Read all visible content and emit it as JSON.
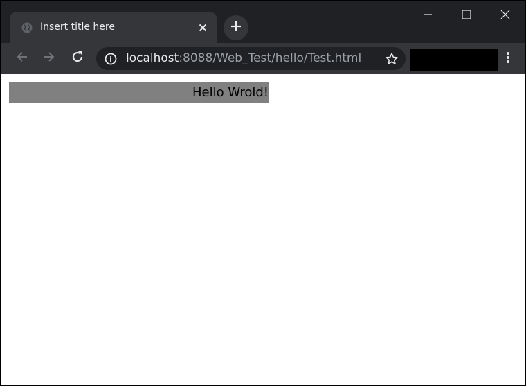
{
  "tab": {
    "title": "Insert title here"
  },
  "omnibox": {
    "host": "localhost",
    "path": ":8088/Web_Test/hello/Test.html"
  },
  "page": {
    "hello_text": "Hello Wrold!"
  },
  "colors": {
    "frame": "#202124",
    "tab_active": "#35363a",
    "page_bg": "#ffffff",
    "hello_bg": "#808080",
    "redacted": "#000000"
  },
  "icons": [
    "globe-icon",
    "close-icon",
    "plus-icon",
    "minimize-icon",
    "maximize-icon",
    "window-close-icon",
    "back-arrow-icon",
    "forward-arrow-icon",
    "reload-icon",
    "info-icon",
    "star-icon",
    "more-vert-icon"
  ]
}
